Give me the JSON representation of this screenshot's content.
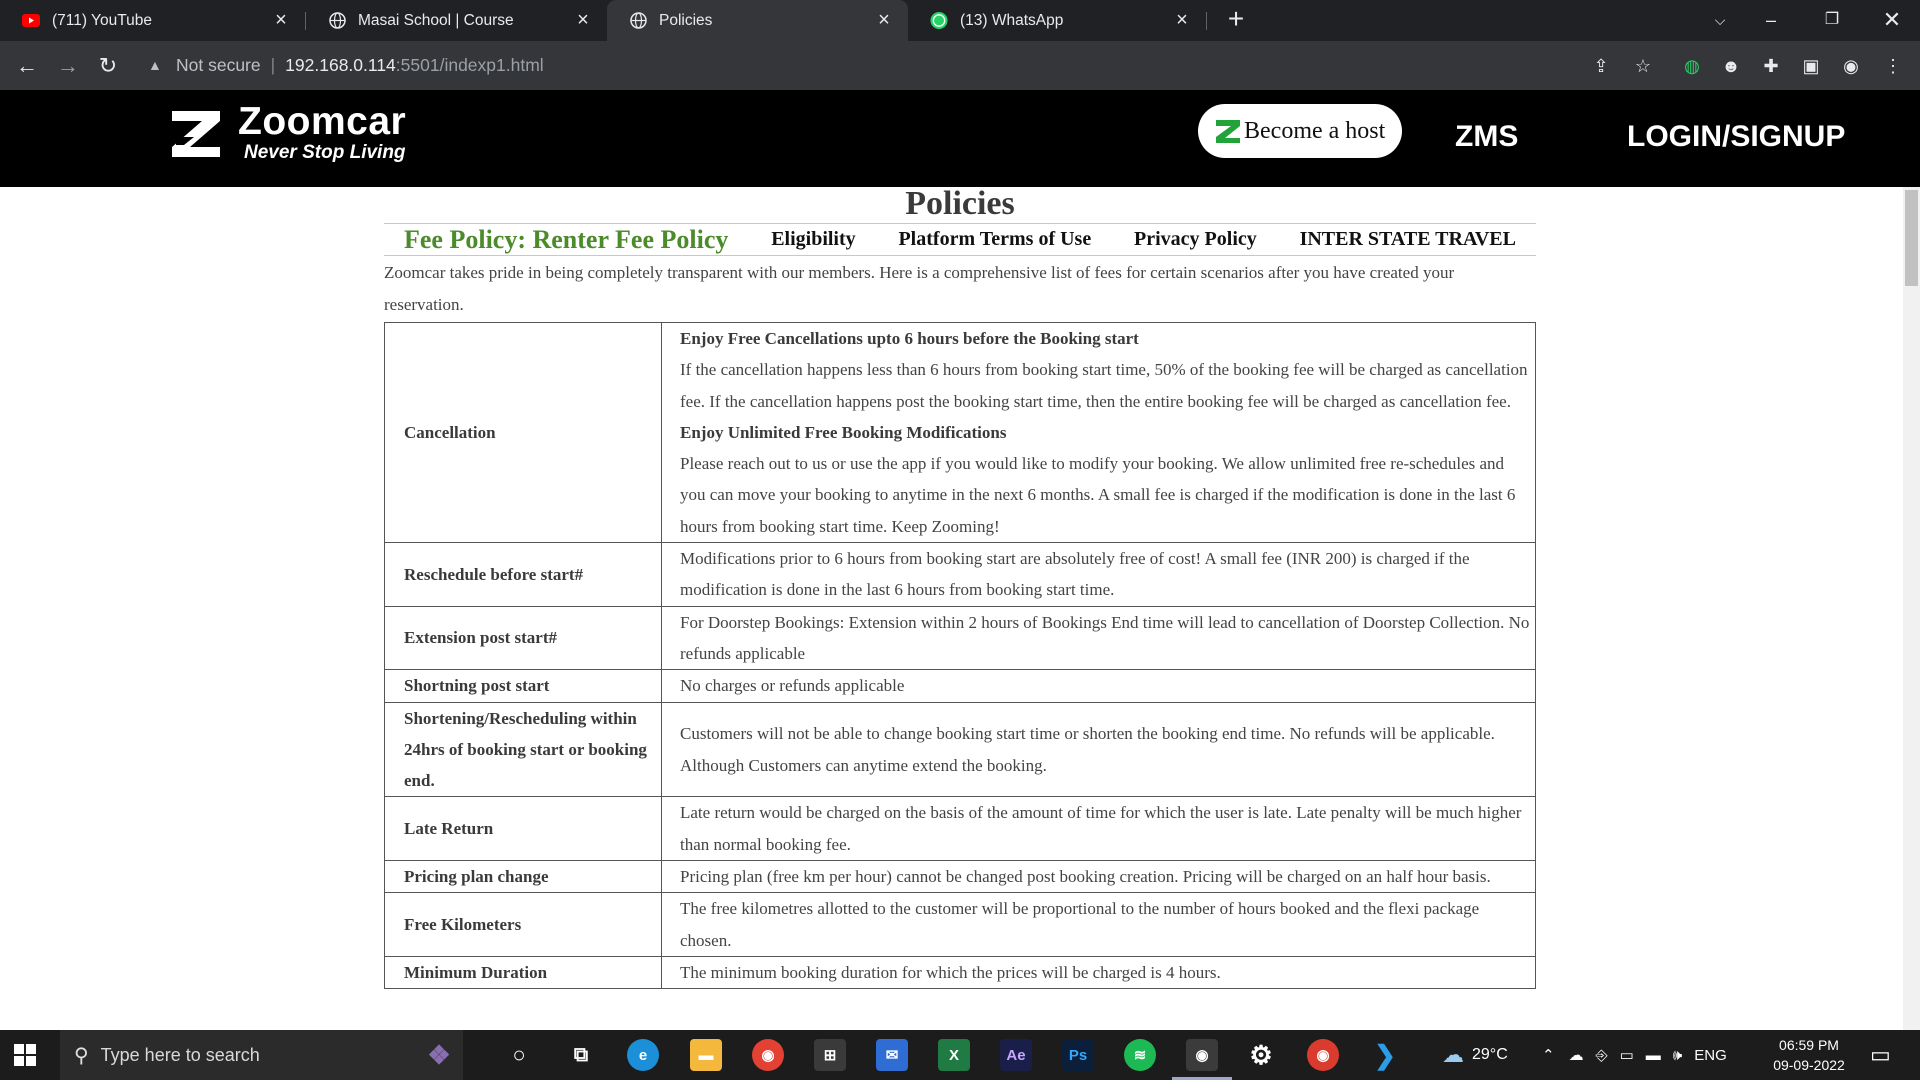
{
  "browser": {
    "tabs": [
      {
        "title": "(711) YouTube",
        "icon": "youtube-icon",
        "active": false
      },
      {
        "title": "Masai School | Course",
        "icon": "globe-icon",
        "active": false
      },
      {
        "title": "Policies",
        "icon": "globe-icon",
        "active": true
      },
      {
        "title": "(13) WhatsApp",
        "icon": "whatsapp-icon",
        "active": false
      }
    ],
    "address": {
      "security_label": "Not secure",
      "host": "192.168.0.114",
      "path": ":5501/indexp1.html"
    }
  },
  "site": {
    "brand": "Zoomcar",
    "tagline": "Never Stop Living",
    "become_host": "Become a host",
    "zms": "ZMS",
    "login": "LOGIN/SIGNUP",
    "accent": "#4b8b2a"
  },
  "page": {
    "title": "Policies",
    "nav": {
      "active": "Fee Policy: Renter Fee Policy",
      "eligibility": "Eligibility",
      "terms": "Platform Terms of Use",
      "privacy": "Privacy Policy",
      "interstate": "INTER STATE TRAVEL"
    },
    "intro": "Zoomcar takes pride in being completely transparent with our members. Here is a comprehensive list of fees for certain scenarios after you have created your reservation.",
    "fees": {
      "cancellation": {
        "label": "Cancellation",
        "h1": "Enjoy Free Cancellations upto 6 hours before the Booking start",
        "p1": "If the cancellation happens less than 6 hours from booking start time, 50% of the booking fee will be charged as cancellation fee. If the cancellation happens post the booking start time, then the entire booking fee will be charged as cancellation fee.",
        "h2": "Enjoy Unlimited Free Booking Modifications",
        "p2": "Please reach out to us or use the app if you would like to modify your booking. We allow unlimited free re-schedules and you can move your booking to anytime in the next 6 months. A small fee is charged if the modification is done in the last 6 hours from booking start time. Keep Zooming!"
      },
      "reschedule": {
        "label": "Reschedule before start#",
        "text": "Modifications prior to 6 hours from booking start are absolutely free of cost! A small fee (INR 200) is charged if the modification is done in the last 6 hours from booking start time."
      },
      "extension": {
        "label": "Extension post start#",
        "text": "For Doorstep Bookings: Extension within 2 hours of Bookings End time will lead to cancellation of Doorstep Collection. No refunds applicable"
      },
      "shortning": {
        "label": "Shortning post start",
        "text": "No charges or refunds applicable"
      },
      "shortening24": {
        "label": "Shortening/Rescheduling within 24hrs of booking start or booking end.",
        "text": "Customers will not be able to change booking start time or shorten the booking end time. No refunds will be applicable. Although Customers can anytime extend the booking."
      },
      "late": {
        "label": "Late Return",
        "text": "Late return would be charged on the basis of the amount of time for which the user is late. Late penalty will be much higher than normal booking fee."
      },
      "pricing": {
        "label": "Pricing plan change",
        "text": "Pricing plan (free km per hour) cannot be changed post booking creation. Pricing will be charged on an half hour basis."
      },
      "freekm": {
        "label": "Free Kilometers",
        "text": "The free kilometres allotted to the customer will be proportional to the number of hours booked and the flexi package chosen."
      },
      "minduration": {
        "label": "Minimum Duration",
        "text": "The minimum booking duration for which the prices will be charged is 4 hours."
      }
    }
  },
  "taskbar": {
    "search_placeholder": "Type here to search",
    "temperature": "29°C",
    "language": "ENG",
    "time": "06:59 PM",
    "date": "09-09-2022"
  }
}
